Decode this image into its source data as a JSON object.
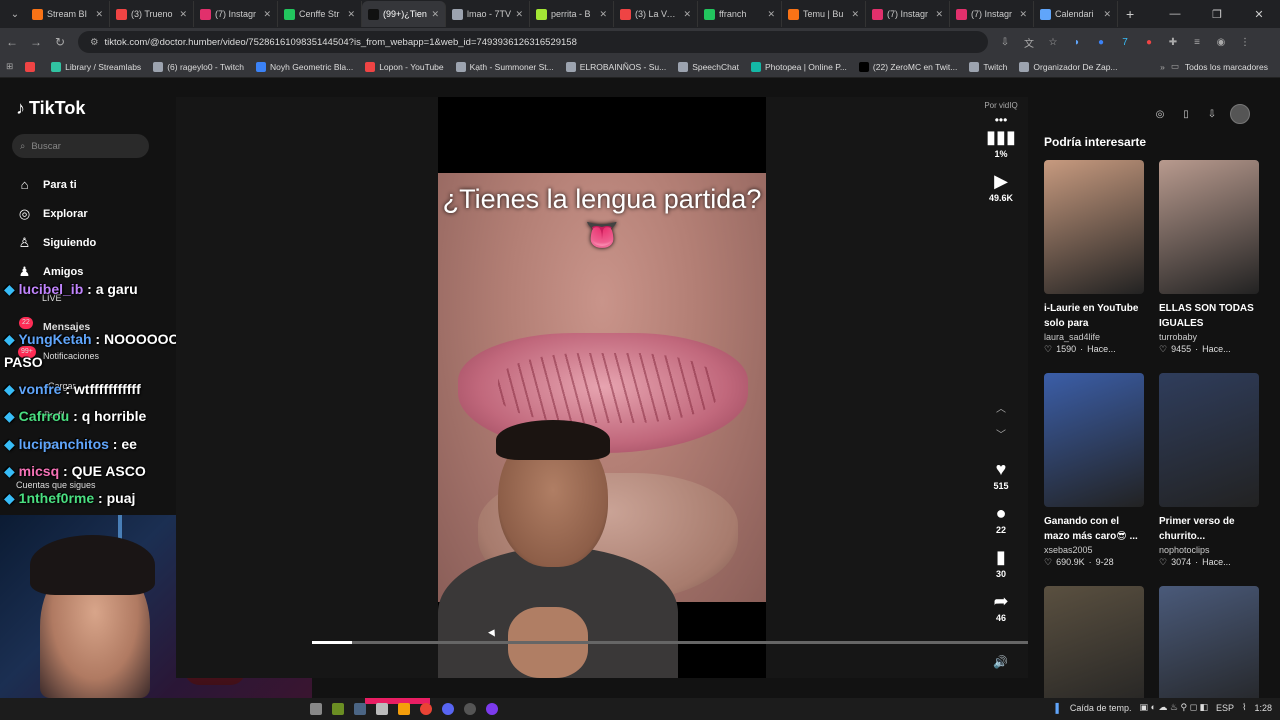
{
  "browser": {
    "tabs": [
      {
        "label": "Stream BI",
        "color": "#f97316"
      },
      {
        "label": "(3) Trueno",
        "color": "#ef4444"
      },
      {
        "label": "(7) Instagr",
        "color": "#e1306c"
      },
      {
        "label": "Cenffe Str",
        "color": "#22c55e"
      },
      {
        "label": "(99+)¿Tien",
        "color": "#111111",
        "active": true
      },
      {
        "label": "lmao - 7TV",
        "color": "#9ca3af"
      },
      {
        "label": "perrita - B",
        "color": "#a3e635"
      },
      {
        "label": "(3) La Verd",
        "color": "#ef4444"
      },
      {
        "label": "ffranch",
        "color": "#22c55e"
      },
      {
        "label": "Temu | Bu",
        "color": "#f97316"
      },
      {
        "label": "(7) Instagr",
        "color": "#e1306c"
      },
      {
        "label": "(7) Instagr",
        "color": "#e1306c"
      },
      {
        "label": "Calendari",
        "color": "#60a5fa"
      }
    ],
    "url": "tiktok.com/@doctor.humber/video/7528616109835144504?is_from_webapp=1&web_id=7493936126316529158",
    "bookmarks": [
      {
        "label": "",
        "color": "#ef4444"
      },
      {
        "label": "Library / Streamlabs",
        "color": "#31c3a2"
      },
      {
        "label": "(6) rageylo0 - Twitch",
        "color": "#9ca3af"
      },
      {
        "label": "Noyh Geometric Bla...",
        "color": "#3b82f6"
      },
      {
        "label": "Lopon - YouTube",
        "color": "#ef4444"
      },
      {
        "label": "Kạth - Summoner St...",
        "color": "#9ca3af"
      },
      {
        "label": "ELROBAINÑOS - Su...",
        "color": "#9ca3af"
      },
      {
        "label": "SpeechChat",
        "color": "#9ca3af"
      },
      {
        "label": "Photopea | Online P...",
        "color": "#14b8a6"
      },
      {
        "label": "(22) ZeroMC en Twit...",
        "color": "#000000"
      },
      {
        "label": "Twitch",
        "color": "#9ca3af"
      },
      {
        "label": "Organizador De Zap...",
        "color": "#9ca3af"
      }
    ],
    "bookmarks_all": "Todos los marcadores"
  },
  "tiktok": {
    "logo": "TikTok",
    "search_placeholder": "Buscar",
    "nav": [
      {
        "label": "Para ti",
        "icon": "home-icon"
      },
      {
        "label": "Explorar",
        "icon": "compass-icon"
      },
      {
        "label": "Siguiendo",
        "icon": "following-icon"
      },
      {
        "label": "Amigos",
        "icon": "friends-icon"
      }
    ],
    "video_caption": "¿Tienes la lengua partida? 👅",
    "progress": 0.056,
    "by_label": "Por vidIQ",
    "rail": {
      "percent": "1%",
      "plays": "49.6K",
      "likes": "515",
      "comments": "22",
      "saves": "30",
      "shares": "46"
    },
    "recommend_title": "Podría interesarte",
    "cards": [
      {
        "title": "i-Laurie en YouTube solo para incomodos",
        "user": "laura_sad4life",
        "likes": "1590",
        "when": "Hace...",
        "thumb": "#c79a7f"
      },
      {
        "title": "ELLAS SON TODAS IGUALES #turrobab...",
        "user": "turrobaby",
        "likes": "9455",
        "when": "Hace...",
        "thumb": "#b89a8e"
      },
      {
        "title": "Ganando con el mazo más caro😎 ...",
        "user": "xsebas2005",
        "likes": "690.9K",
        "when": "9-28",
        "thumb": "#3b5ea8"
      },
      {
        "title": "Primer verso de churrito...",
        "user": "nophotoclips",
        "likes": "3074",
        "when": "Hace...",
        "thumb": "#2f3d5c"
      },
      {
        "title": "",
        "user": "",
        "likes": "",
        "when": "",
        "thumb": "#5a5040"
      },
      {
        "title": "",
        "user": "",
        "likes": "",
        "when": "",
        "thumb": "#4a5a7a"
      }
    ]
  },
  "stream_chat": [
    {
      "user": "lucibel_ib",
      "msg": "a garu"
    },
    {
      "user": "YungKetah",
      "msg": "NOOOOOOO PERO Q LE PASO"
    },
    {
      "user": "vonfre",
      "msg": "wtfffffffffff"
    },
    {
      "user": "Cafrrou",
      "msg": "q horrible"
    },
    {
      "user": "lucipanchitos",
      "msg": "ee"
    },
    {
      "user": "micsq",
      "msg": "QUE ASCO"
    },
    {
      "user": "1nthef0rme",
      "msg": "puaj"
    }
  ],
  "overlay_labels": {
    "live": "LIVE",
    "mensajes": "Mensajes",
    "notificaciones": "Notificaciones",
    "badge": "99+",
    "cargar": "Cargar",
    "perfil": "Perfil",
    "mas": "Más",
    "cuentas": "Cuentas que sigues",
    "unread": "22"
  },
  "taskbar": {
    "weather": "Caída de temp.",
    "lang": "ESP",
    "time": "1:28"
  }
}
